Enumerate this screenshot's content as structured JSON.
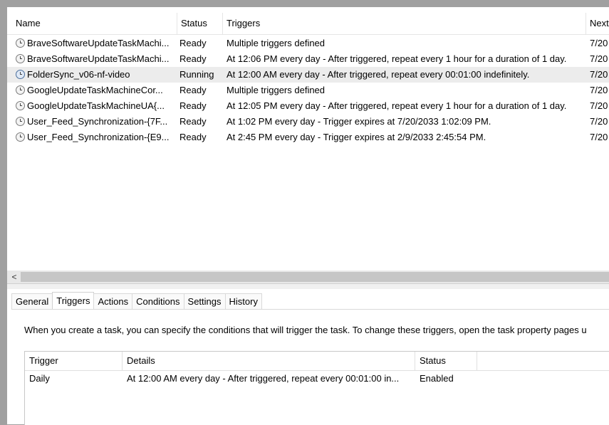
{
  "task_list": {
    "columns": [
      "Name",
      "Status",
      "Triggers",
      "Next"
    ],
    "rows": [
      {
        "name": "BraveSoftwareUpdateTaskMachi...",
        "status": "Ready",
        "triggers": "Multiple triggers defined",
        "next": "7/20",
        "icon": "clock-icon"
      },
      {
        "name": "BraveSoftwareUpdateTaskMachi...",
        "status": "Ready",
        "triggers": "At 12:06 PM every day - After triggered, repeat every 1 hour for a duration of 1 day.",
        "next": "7/20",
        "icon": "clock-icon"
      },
      {
        "name": "FolderSync_v06-nf-video",
        "status": "Running",
        "triggers": "At 12:00 AM every day - After triggered, repeat every 00:01:00 indefinitely.",
        "next": "7/20",
        "icon": "clock-running-icon"
      },
      {
        "name": "GoogleUpdateTaskMachineCor...",
        "status": "Ready",
        "triggers": "Multiple triggers defined",
        "next": "7/20",
        "icon": "clock-icon"
      },
      {
        "name": "GoogleUpdateTaskMachineUA{...",
        "status": "Ready",
        "triggers": "At 12:05 PM every day - After triggered, repeat every 1 hour for a duration of 1 day.",
        "next": "7/20",
        "icon": "clock-icon"
      },
      {
        "name": "User_Feed_Synchronization-{7F...",
        "status": "Ready",
        "triggers": "At 1:02 PM every day - Trigger expires at 7/20/2033 1:02:09 PM.",
        "next": "7/20",
        "icon": "clock-icon"
      },
      {
        "name": "User_Feed_Synchronization-{E9...",
        "status": "Ready",
        "triggers": "At 2:45 PM every day - Trigger expires at 2/9/2033 2:45:54 PM.",
        "next": "7/20",
        "icon": "clock-icon"
      }
    ],
    "scroll_left_arrow": "<"
  },
  "detail": {
    "tabs": [
      "General",
      "Triggers",
      "Actions",
      "Conditions",
      "Settings",
      "History"
    ],
    "active_tab": "Triggers",
    "description": "When you create a task, you can specify the conditions that will trigger the task.  To change these triggers, open the task property pages u",
    "trigger_table": {
      "columns": [
        "Trigger",
        "Details",
        "Status"
      ],
      "rows": [
        {
          "trigger": "Daily",
          "details": "At 12:00 AM every day - After triggered, repeat every 00:01:00 in...",
          "status": "Enabled"
        }
      ]
    }
  }
}
